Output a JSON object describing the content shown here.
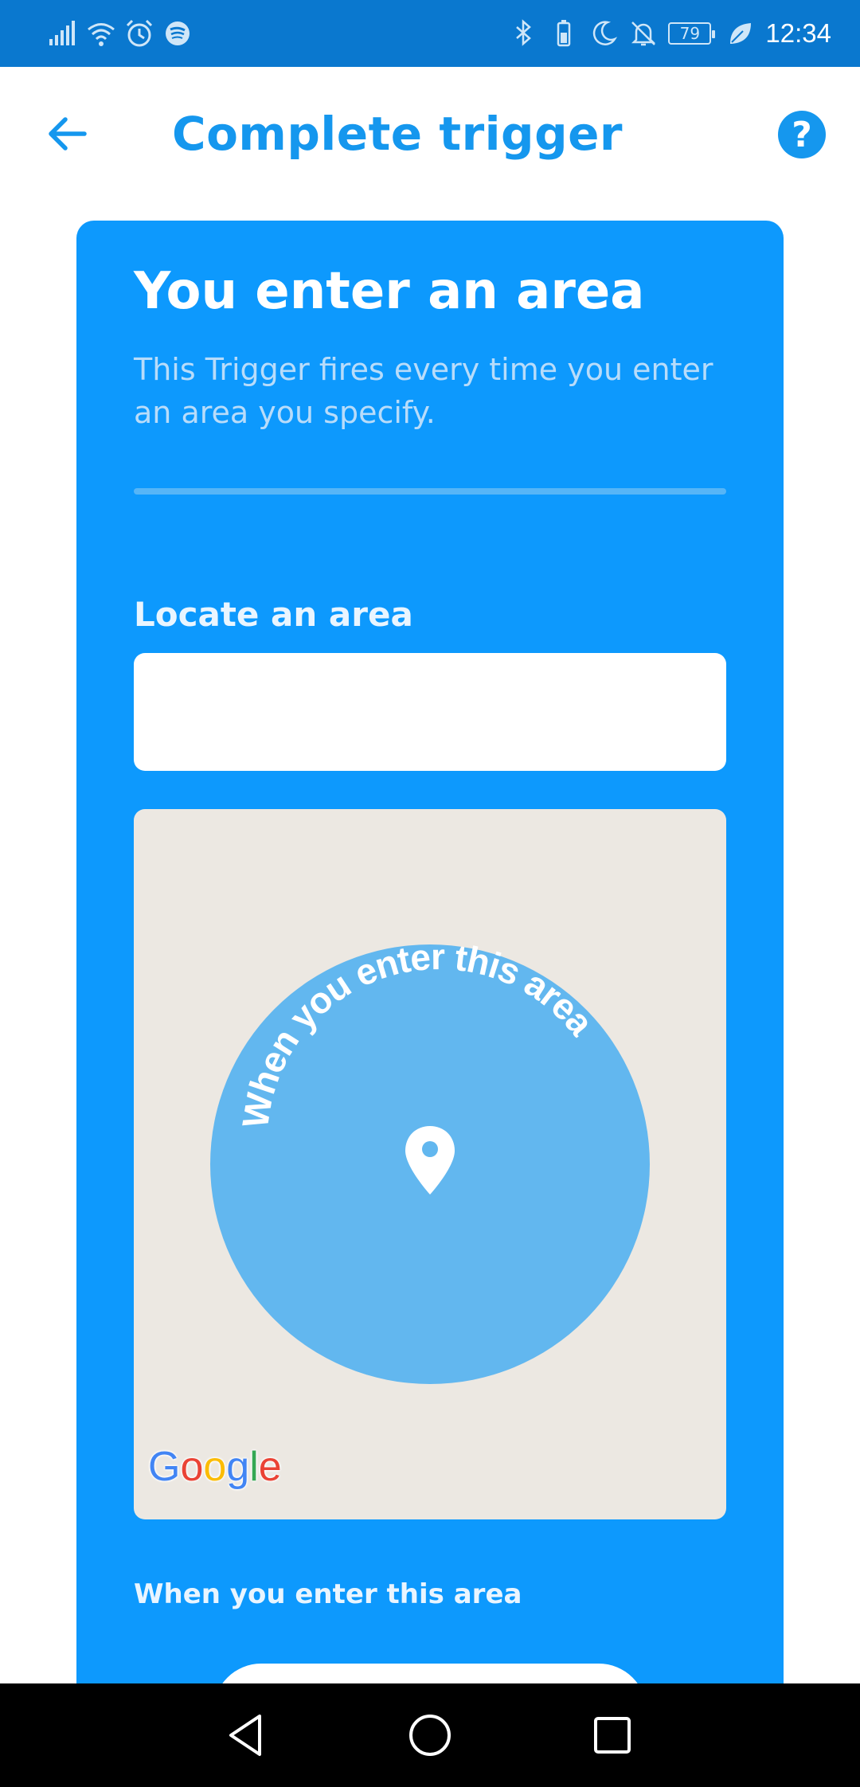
{
  "status_bar": {
    "time": "12:34",
    "battery_level": "79",
    "left_icons": [
      "signal-icon",
      "wifi-icon",
      "alarm-icon",
      "spotify-icon"
    ],
    "right_icons": [
      "bluetooth-icon",
      "battery-saver-icon",
      "moon-icon",
      "bell-off-icon",
      "battery-icon",
      "leaf-icon"
    ]
  },
  "header": {
    "title": "Complete trigger",
    "help_label": "?"
  },
  "card": {
    "title": "You enter an area",
    "description": "This Trigger fires every time you enter an area you specify.",
    "field_label": "Locate an area",
    "search": {
      "value": "",
      "placeholder": ""
    },
    "map": {
      "arc_text": "When you enter this area",
      "attribution": "Google"
    },
    "area_caption": "When you enter this area"
  },
  "colors": {
    "status_bar": "#0a78cf",
    "accent": "#1597ee",
    "card": "#0d99fd",
    "circle": "#62b7ef",
    "map_bg": "#ece8e2"
  }
}
